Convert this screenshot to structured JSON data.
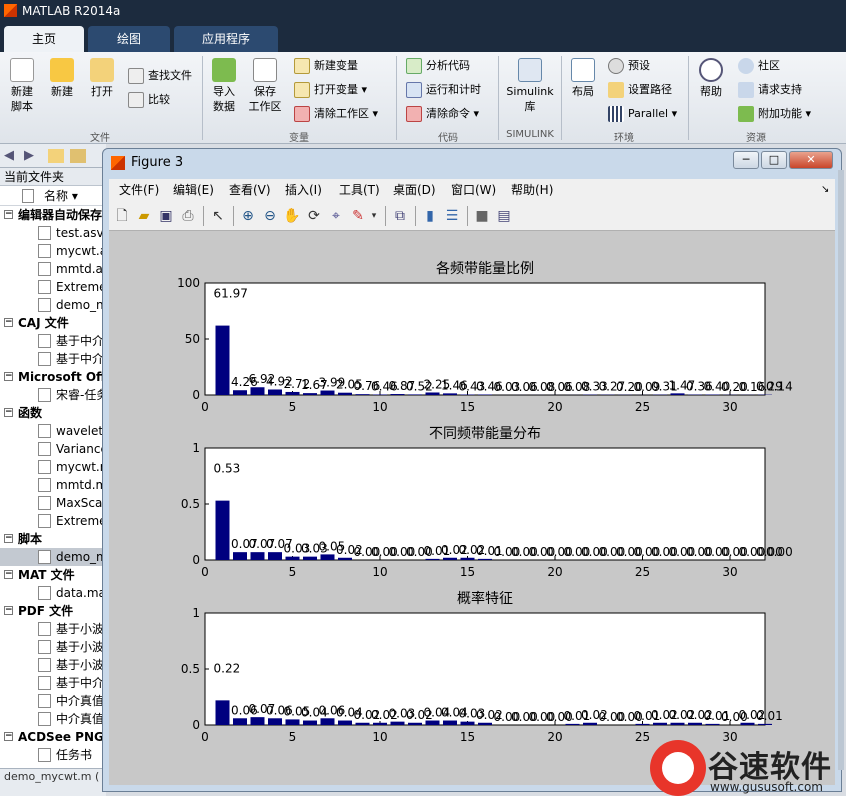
{
  "app": {
    "title": "MATLAB R2014a"
  },
  "tabs": [
    "主页",
    "绘图",
    "应用程序"
  ],
  "ribbon": {
    "new_script": "新建\n脚本",
    "new": "新建",
    "open": "打开",
    "find_files": "查找文件",
    "compare": "比较",
    "import_data": "导入\n数据",
    "save_workspace": "保存\n工作区",
    "new_variable": "新建变量",
    "open_variable": "打开变量",
    "clear_workspace": "清除工作区",
    "analyze_code": "分析代码",
    "run_and_time": "运行和计时",
    "clear_commands": "清除命令",
    "simulink": "Simulink\n库",
    "layout": "布局",
    "preferences": "预设",
    "set_path": "设置路径",
    "parallel": "Parallel",
    "help": "帮助",
    "community": "社区",
    "request_support": "请求支持",
    "addons": "附加功能",
    "groups": [
      "文件",
      "变量",
      "代码",
      "SIMULINK",
      "环境",
      "资源"
    ]
  },
  "left_panel": {
    "title": "当前文件夹",
    "column_name": "名称 ▾",
    "groups": [
      {
        "label": "编辑器自动保存",
        "items": [
          "test.asv",
          "mycwt.a",
          "mmtd.a",
          "Extreme",
          "demo_n"
        ]
      },
      {
        "label": "CAJ 文件",
        "items": [
          "基于中介",
          "基于中介"
        ]
      },
      {
        "label": "Microsoft Off",
        "items": [
          "宋睿-任务"
        ]
      },
      {
        "label": "函数",
        "items": [
          "wavelet",
          "Variance",
          "mycwt.m",
          "mmtd.m",
          "MaxSca",
          "Extreme"
        ]
      },
      {
        "label": "脚本",
        "items": [
          "demo_m"
        ]
      },
      {
        "label": "MAT 文件",
        "items": [
          "data.ma"
        ]
      },
      {
        "label": "PDF 文件",
        "items": [
          "基于小波",
          "基于小波",
          "基于小波",
          "基于中介",
          "中介真值",
          "中介真值"
        ]
      },
      {
        "label": "ACDSee PNG",
        "items": [
          "任务书"
        ]
      }
    ],
    "status": "demo_mycwt.m ("
  },
  "figure": {
    "title": "Figure 3",
    "window_buttons": [
      "─",
      "□",
      "✕"
    ],
    "menus": [
      "文件(F)",
      "编辑(E)",
      "查看(V)",
      "插入(I)",
      "工具(T)",
      "桌面(D)",
      "窗口(W)",
      "帮助(H)"
    ],
    "toolbar_icons": [
      "new-figure-icon",
      "open-icon",
      "save-icon",
      "print-icon",
      "pointer-icon",
      "zoom-in-icon",
      "zoom-out-icon",
      "pan-icon",
      "rotate-icon",
      "data-cursor-icon",
      "brush-icon",
      "link-icon",
      "colorbar-icon",
      "legend-icon",
      "hide-plot-tools-icon",
      "show-plot-tools-icon"
    ]
  },
  "chart_data": [
    {
      "type": "bar",
      "title": "各频带能量比例",
      "xlim": [
        0,
        32
      ],
      "ylim": [
        0,
        100
      ],
      "xticks": [
        0,
        5,
        10,
        15,
        20,
        25,
        30
      ],
      "yticks": [
        0,
        50,
        100
      ],
      "x": [
        1,
        2,
        3,
        4,
        5,
        6,
        7,
        8,
        9,
        10,
        11,
        12,
        13,
        14,
        15,
        16,
        17,
        18,
        19,
        20,
        21,
        22,
        23,
        24,
        25,
        26,
        27,
        28,
        29,
        30,
        31,
        32
      ],
      "values": [
        61.97,
        4.26,
        6.92,
        4.92,
        2.72,
        1.67,
        3.99,
        2.05,
        0.76,
        0.46,
        0.87,
        0.52,
        2.25,
        1.46,
        0.43,
        0.46,
        0.03,
        0.06,
        0.08,
        0.06,
        0.08,
        0.33,
        0.27,
        0.2,
        0.09,
        0.31,
        1.47,
        0.36,
        0.4,
        0.2,
        0.16,
        0.29
      ],
      "labels": [
        "61.97",
        "4.26",
        "6.92",
        "4.92",
        "2.72",
        "1.67",
        "3.99",
        "2.05",
        "0.76",
        "0.46",
        "0.87",
        "0.52",
        "2.25",
        "1.46",
        "0.43",
        "0.46",
        "0.03",
        "0.06",
        "0.08",
        "0.06",
        "0.08",
        "0.33",
        "0.27",
        "0.20",
        "0.09",
        "0.31",
        "1.47",
        "0.36",
        "0.40",
        "0.20",
        "0.16",
        "0.29"
      ],
      "extra_label": "0.14"
    },
    {
      "type": "bar",
      "title": "不同频带能量分布",
      "xlim": [
        0,
        32
      ],
      "ylim": [
        0,
        1
      ],
      "xticks": [
        0,
        5,
        10,
        15,
        20,
        25,
        30
      ],
      "yticks": [
        0,
        0.5,
        1
      ],
      "ytick_labels": [
        "0",
        "0.5",
        "1"
      ],
      "x": [
        1,
        2,
        3,
        4,
        5,
        6,
        7,
        8,
        9,
        10,
        11,
        12,
        13,
        14,
        15,
        16,
        17,
        18,
        19,
        20,
        21,
        22,
        23,
        24,
        25,
        26,
        27,
        28,
        29,
        30,
        31,
        32
      ],
      "values": [
        0.53,
        0.07,
        0.07,
        0.07,
        0.03,
        0.03,
        0.05,
        0.02,
        0.0,
        0.0,
        0.0,
        0.0,
        0.01,
        0.02,
        0.02,
        0.01,
        0.0,
        0.0,
        0.0,
        0.0,
        0.0,
        0.0,
        0.0,
        0.0,
        0.0,
        0.0,
        0.0,
        0.0,
        0.0,
        0.0,
        0.0,
        0.0
      ],
      "labels": [
        "0.53",
        "0.07",
        "0.07",
        "0.07",
        "0.03",
        "0.03",
        "0.05",
        "0.02",
        "0.00",
        "0.00",
        "0.00",
        "0.00",
        "0.01",
        "0.02",
        "0.02",
        "0.01",
        "0.00",
        "0.00",
        "0.00",
        "0.00",
        "0.00",
        "0.00",
        "0.00",
        "0.00",
        "0.00",
        "0.00",
        "0.00",
        "0.00",
        "0.00",
        "0.00",
        "0.00",
        "0.00"
      ],
      "extra_label": "0.00"
    },
    {
      "type": "bar",
      "title": "概率特征",
      "xlim": [
        0,
        32
      ],
      "ylim": [
        0,
        1
      ],
      "xticks": [
        0,
        5,
        10,
        15,
        20,
        25,
        30
      ],
      "yticks": [
        0,
        0.5,
        1
      ],
      "ytick_labels": [
        "0",
        "0.5",
        "1"
      ],
      "x": [
        1,
        2,
        3,
        4,
        5,
        6,
        7,
        8,
        9,
        10,
        11,
        12,
        13,
        14,
        15,
        16,
        17,
        18,
        19,
        20,
        21,
        22,
        23,
        24,
        25,
        26,
        27,
        28,
        29,
        30,
        31,
        32
      ],
      "values": [
        0.22,
        0.06,
        0.07,
        0.06,
        0.05,
        0.04,
        0.06,
        0.04,
        0.02,
        0.02,
        0.03,
        0.02,
        0.04,
        0.04,
        0.03,
        0.02,
        0.0,
        0.0,
        0.0,
        0.0,
        0.01,
        0.02,
        0.0,
        0.0,
        0.01,
        0.02,
        0.02,
        0.02,
        0.01,
        0.0,
        0.02,
        0.01
      ],
      "labels": [
        "0.22",
        "0.06",
        "0.07",
        "0.06",
        "0.05",
        "0.04",
        "0.06",
        "0.04",
        "0.02",
        "0.02",
        "0.03",
        "0.02",
        "0.04",
        "0.04",
        "0.03",
        "0.02",
        "0.00",
        "0.00",
        "0.00",
        "0.00",
        "0.01",
        "0.02",
        "0.00",
        "0.00",
        "0.01",
        "0.02",
        "0.02",
        "0.02",
        "0.01",
        "0.00",
        "0.02",
        "0.01"
      ],
      "extra_label": ""
    }
  ],
  "colors": {
    "bar": "#00007f",
    "axes_bg": "#ffffff",
    "figure_bg": "#c8c8c8",
    "title_bar": "#1c2b3e"
  },
  "watermark": {
    "text": "谷速软件",
    "url": "www.gususoft.com"
  }
}
